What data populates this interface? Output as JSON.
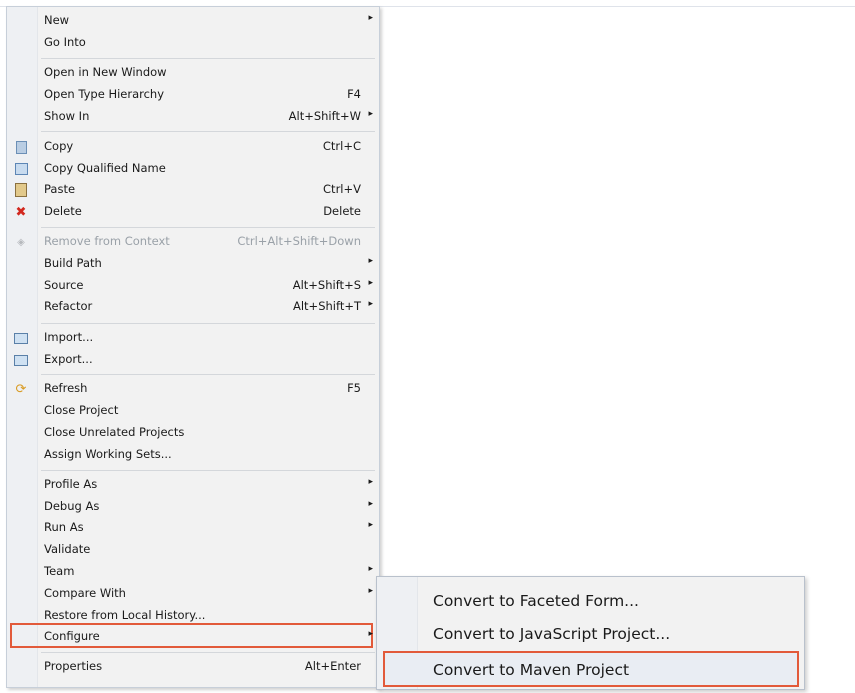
{
  "context_menu": {
    "items": [
      {
        "label": "New",
        "shortcut": "",
        "submenu": true
      },
      {
        "label": "Go Into",
        "shortcut": ""
      },
      {
        "label": "Open in New Window",
        "shortcut": ""
      },
      {
        "label": "Open Type Hierarchy",
        "shortcut": "F4"
      },
      {
        "label": "Show In",
        "shortcut": "Alt+Shift+W",
        "submenu": true
      },
      {
        "label": "Copy",
        "shortcut": "Ctrl+C",
        "icon": "copy-icon"
      },
      {
        "label": "Copy Qualified Name",
        "shortcut": "",
        "icon": "copy-qualified-name-icon"
      },
      {
        "label": "Paste",
        "shortcut": "Ctrl+V",
        "icon": "paste-icon"
      },
      {
        "label": "Delete",
        "shortcut": "Delete",
        "icon": "delete-icon"
      },
      {
        "label": "Remove from Context",
        "shortcut": "Ctrl+Alt+Shift+Down",
        "icon": "remove-from-context-icon",
        "disabled": true
      },
      {
        "label": "Build Path",
        "shortcut": "",
        "submenu": true
      },
      {
        "label": "Source",
        "shortcut": "Alt+Shift+S",
        "submenu": true
      },
      {
        "label": "Refactor",
        "shortcut": "Alt+Shift+T",
        "submenu": true
      },
      {
        "label": "Import...",
        "shortcut": "",
        "icon": "import-icon"
      },
      {
        "label": "Export...",
        "shortcut": "",
        "icon": "export-icon"
      },
      {
        "label": "Refresh",
        "shortcut": "F5",
        "icon": "refresh-icon"
      },
      {
        "label": "Close Project",
        "shortcut": ""
      },
      {
        "label": "Close Unrelated Projects",
        "shortcut": ""
      },
      {
        "label": "Assign Working Sets...",
        "shortcut": ""
      },
      {
        "label": "Profile As",
        "shortcut": "",
        "submenu": true
      },
      {
        "label": "Debug As",
        "shortcut": "",
        "submenu": true
      },
      {
        "label": "Run As",
        "shortcut": "",
        "submenu": true
      },
      {
        "label": "Validate",
        "shortcut": ""
      },
      {
        "label": "Team",
        "shortcut": "",
        "submenu": true
      },
      {
        "label": "Compare With",
        "shortcut": "",
        "submenu": true
      },
      {
        "label": "Restore from Local History...",
        "shortcut": ""
      },
      {
        "label": "Configure",
        "shortcut": "",
        "submenu": true,
        "highlighted": true
      },
      {
        "label": "Properties",
        "shortcut": "Alt+Enter"
      }
    ],
    "submenu_arrow": "▸"
  },
  "configure_submenu": {
    "items": [
      {
        "label": "Convert to Faceted Form..."
      },
      {
        "label": "Convert to JavaScript Project..."
      },
      {
        "label": "Convert to Maven Project",
        "highlighted": true
      }
    ]
  },
  "colors": {
    "highlight_border": "#e25a3a",
    "menu_bg": "#f2f2f2"
  }
}
